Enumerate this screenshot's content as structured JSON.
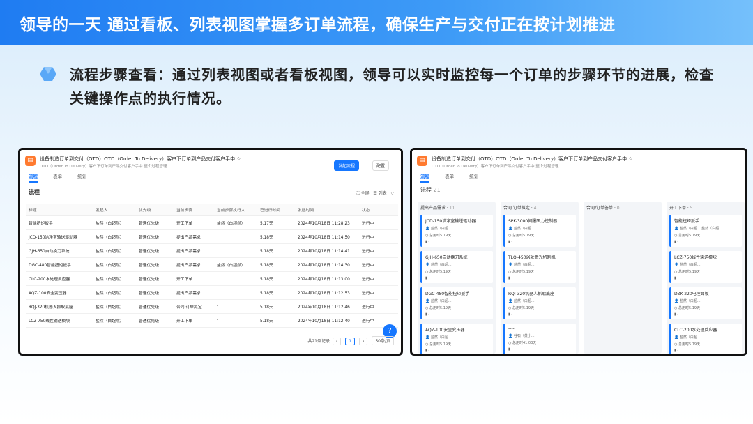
{
  "banner": {
    "title": "领导的一天 通过看板、列表视图掌握多订单流程，确保生产与交付正在按计划推进"
  },
  "description": "流程步骤查看：通过列表视图或者看板视图，领导可以实时监控每一个订单的步骤环节的进展，检查关键操作点的执行情况。",
  "app": {
    "title": "设备制造订单到交付（OTD）OTD（Order To Delivery）客户下订单到产品交付客户手中 ☆",
    "subtitle": "OTD（Order To Delivery）客户下订单到产品交付客户手中 整个过程管理",
    "tabs": [
      "流程",
      "表单",
      "统计"
    ],
    "start_button": "发起流程",
    "config_button": "配置"
  },
  "list_view": {
    "section_title": "流程",
    "tools": [
      "全屏",
      "列表"
    ],
    "columns": [
      "标题",
      "发起人",
      "优先级",
      "当前步骤",
      "当前步骤执行人",
      "已进行时间",
      "发起时间",
      "状态"
    ],
    "rows": [
      [
        "智能扭矩扳手",
        "盐然（白超然）",
        "普通优先级",
        "开工下单",
        "盐然（白超然）",
        "5.17天",
        "2024年10月18日 11:28:23",
        "进行中"
      ],
      [
        "JCD-150洁净室输送驱动器",
        "盐然（白超然）",
        "普通优先级",
        "提出产品需求",
        "-",
        "5.18天",
        "2024年10月18日 11:14:50",
        "进行中"
      ],
      [
        "GJH-650自动换刀系统",
        "盐然（白超然）",
        "普通优先级",
        "提出产品需求",
        "-",
        "5.18天",
        "2024年10月18日 11:14:41",
        "进行中"
      ],
      [
        "DGC-480智能扭矩扳手",
        "盐然（白超然）",
        "普通优先级",
        "提出产品需求",
        "盐然（白超然）",
        "5.18天",
        "2024年10月18日 11:14:30",
        "进行中"
      ],
      [
        "CLC-200水处理反应器",
        "盐然（白超然）",
        "普通优先级",
        "开工下单",
        "-",
        "5.18天",
        "2024年10月18日 11:13:00",
        "进行中"
      ],
      [
        "AQZ-100安全变压器",
        "盐然（白超然）",
        "普通优先级",
        "提出产品需求",
        "-",
        "5.18天",
        "2024年10月18日 11:12:53",
        "进行中"
      ],
      [
        "RQJ-320机器人抓取底座",
        "盐然（白超然）",
        "普通优先级",
        "合同 订单拟定",
        "-",
        "5.18天",
        "2024年10月18日 11:12:46",
        "进行中"
      ],
      [
        "LCZ-750线性输送模块",
        "盐然（白超然）",
        "普通优先级",
        "开工下单",
        "-",
        "5.18天",
        "2024年10月18日 11:12:40",
        "进行中"
      ]
    ],
    "pager": {
      "total": "共21条记录",
      "page": "1",
      "size": "50条/页"
    }
  },
  "board_view": {
    "section_title": "流程",
    "count": "21",
    "columns": [
      {
        "name": "提出产品需求",
        "count": "11",
        "cards": [
          {
            "title": "JCD-150洁净室输送驱动器",
            "owner": "盐然（白超...",
            "time": "总用时5.19天",
            "extra": "-"
          },
          {
            "title": "GJH-650自动换刀系统",
            "owner": "盐然（白超...",
            "time": "总用时5.19天",
            "extra": "-"
          },
          {
            "title": "DGC-480智能扭矩扳手",
            "owner": "盐然（白超...",
            "time": "总用时5.19天",
            "extra": "-"
          },
          {
            "title": "AQZ-100安全变压器",
            "owner": "盐然（白超...",
            "time": "总用时5.19天",
            "extra": "-"
          }
        ]
      },
      {
        "name": "合同 订单拟定",
        "count": "4",
        "cards": [
          {
            "title": "SPK-3000伺服压力控制器",
            "owner": "盐然（白超...",
            "time": "总用时5.19天",
            "extra": "-"
          },
          {
            "title": "TLQ-450涡轮激光切割机",
            "owner": "盐然（白超...",
            "time": "总用时5.19天",
            "extra": "-"
          },
          {
            "title": "RQJ-320机器人抓取底座",
            "owner": "盐然（白超...",
            "time": "总用时5.19天",
            "extra": "-"
          },
          {
            "title": "----",
            "owner": "谷石（黄小...",
            "time": "总用时41.03天",
            "extra": "-"
          }
        ]
      },
      {
        "name": "合同/订单答单",
        "count": "0",
        "cards": []
      },
      {
        "name": "开工下单",
        "count": "5",
        "cards": [
          {
            "title": "智能扭矩扳手",
            "owner": "盐然（白超...  盐然（白超...",
            "time": "总用时5.19天",
            "extra": "-"
          },
          {
            "title": "LCZ-750线性输送模块",
            "owner": "盐然（白超...",
            "time": "总用时5.19天",
            "extra": "-"
          },
          {
            "title": "DZK-220电控面板",
            "owner": "盐然（白超...",
            "time": "总用时5.19天",
            "extra": "-"
          },
          {
            "title": "CLC-200水处理反应器",
            "owner": "盐然（白超...",
            "time": "总用时5.19天",
            "extra": "-"
          }
        ]
      }
    ]
  }
}
